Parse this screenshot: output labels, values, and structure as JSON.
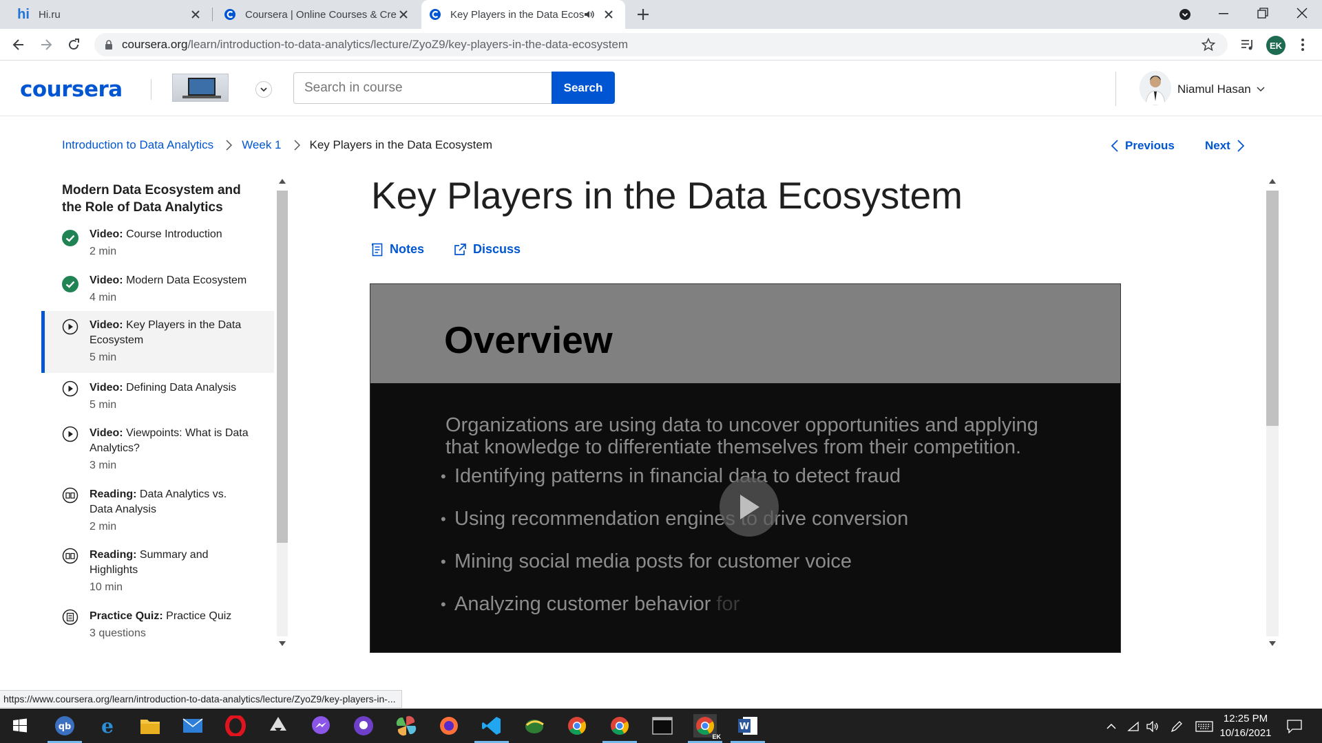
{
  "browser": {
    "tabs": [
      {
        "title": "Hi.ru"
      },
      {
        "title": "Coursera | Online Courses & Cred"
      },
      {
        "title": "Key Players in the Data Ecosy"
      }
    ],
    "url_host": "coursera.org",
    "url_path": "/learn/introduction-to-data-analytics/lecture/ZyoZ9/key-players-in-the-data-ecosystem",
    "profile_initials": "EK"
  },
  "header": {
    "logo": "coursera",
    "search_placeholder": "Search in course",
    "search_label": "Search",
    "user_name": "Niamul Hasan"
  },
  "breadcrumb": {
    "course": "Introduction to Data Analytics",
    "week": "Week 1",
    "current": "Key Players in the Data Ecosystem"
  },
  "pager": {
    "previous": "Previous",
    "next": "Next"
  },
  "sidebar": {
    "section_title": "Modern Data Ecosystem and the Role of Data Analytics",
    "items": [
      {
        "type": "Video:",
        "name": "Course Introduction",
        "duration": "2 min",
        "status": "completed"
      },
      {
        "type": "Video:",
        "name": "Modern Data Ecosystem",
        "duration": "4 min",
        "status": "completed"
      },
      {
        "type": "Video:",
        "name": "Key Players in the Data Ecosystem",
        "duration": "5 min",
        "status": "current"
      },
      {
        "type": "Video:",
        "name": "Defining Data Analysis",
        "duration": "5 min",
        "status": "video"
      },
      {
        "type": "Video:",
        "name": "Viewpoints: What is Data Analytics?",
        "duration": "3 min",
        "status": "video"
      },
      {
        "type": "Reading:",
        "name": "Data Analytics vs. Data Analysis",
        "duration": "2 min",
        "status": "reading"
      },
      {
        "type": "Reading:",
        "name": "Summary and Highlights",
        "duration": "10 min",
        "status": "reading"
      },
      {
        "type": "Practice Quiz:",
        "name": "Practice Quiz",
        "duration": "3 questions",
        "status": "quiz"
      }
    ]
  },
  "main": {
    "title": "Key Players in the Data Ecosystem",
    "notes_label": "Notes",
    "discuss_label": "Discuss"
  },
  "video": {
    "slide_heading": "Overview",
    "paragraph": "Organizations are using data to uncover opportunities and applying that knowledge to differentiate themselves from their competition.",
    "bullets": [
      "Identifying patterns in financial data to detect fraud",
      "Using recommendation engines to drive conversion",
      "Mining social media posts for customer voice"
    ],
    "last_bullet_main": "Analyzing customer behavior ",
    "last_bullet_fade": "for"
  },
  "status_url": "https://www.coursera.org/learn/introduction-to-data-analytics/lecture/ZyoZ9/key-players-in-...",
  "taskbar": {
    "time": "12:25 PM",
    "date": "10/16/2021",
    "chrome_badge": "EK"
  },
  "colors": {
    "brand": "#0056d2",
    "completed": "#1f8354"
  }
}
